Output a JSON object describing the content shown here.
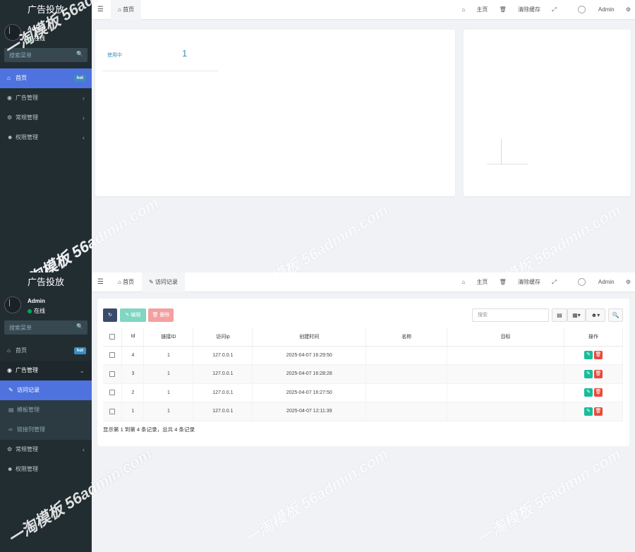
{
  "brand": "广告投放",
  "user": {
    "name": "Admin",
    "status": "在线"
  },
  "sidebar_search_placeholder": "搜索菜单",
  "top": {
    "menu": [
      {
        "label": "首页",
        "badge": "hot"
      },
      {
        "label": "广告管理"
      },
      {
        "label": "常规管理"
      },
      {
        "label": "权限管理"
      }
    ],
    "tabs": [
      "首页"
    ],
    "card": {
      "label": "使用中",
      "value": "1"
    }
  },
  "bottom": {
    "menu": {
      "home": {
        "label": "首页",
        "badge": "hot"
      },
      "ads": {
        "label": "广告管理"
      },
      "sub": [
        "访问记录",
        "模板管理",
        "链接列管理"
      ],
      "general": {
        "label": "常规管理"
      },
      "auth": {
        "label": "权限管理"
      }
    },
    "tabs": [
      "首页",
      "访问记录"
    ],
    "toolbar": {
      "edit": "编辑",
      "delete": "删除",
      "search_placeholder": "搜索"
    },
    "table": {
      "headers": [
        "Id",
        "链接ID",
        "访问ip",
        "创建时间",
        "名称",
        "目标",
        "操作"
      ],
      "rows": [
        {
          "id": "4",
          "link_id": "1",
          "ip": "127.0.0.1",
          "created": "2025-04-07 16:29:50"
        },
        {
          "id": "3",
          "link_id": "1",
          "ip": "127.0.0.1",
          "created": "2025-04-07 16:28:28"
        },
        {
          "id": "2",
          "link_id": "1",
          "ip": "127.0.0.1",
          "created": "2025-04-07 16:27:50"
        },
        {
          "id": "1",
          "link_id": "1",
          "ip": "127.0.0.1",
          "created": "2025-04-07 12:11:39"
        }
      ],
      "pagination": "显示第 1 到第 4 条记录，总共 4 条记录"
    }
  },
  "nav_right": {
    "home": "主页",
    "clear_cache": "清除缓存",
    "user": "Admin"
  },
  "watermark": "一淘模板 56admin.com"
}
